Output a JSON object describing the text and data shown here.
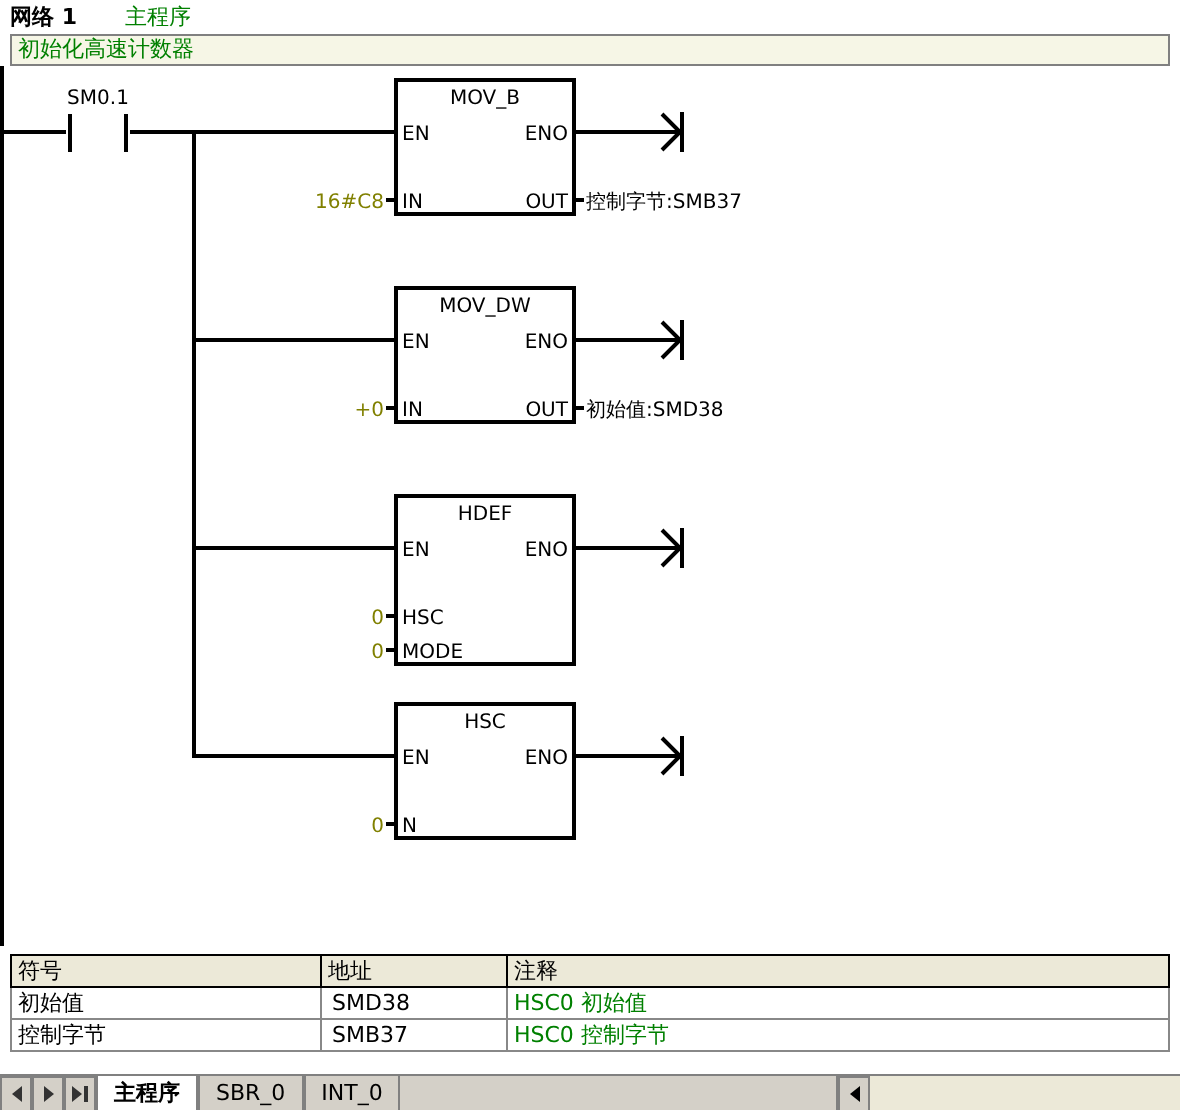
{
  "network": {
    "label": "网络 1",
    "title": "主程序",
    "comment": "初始化高速计数器"
  },
  "contact": {
    "label": "SM0.1"
  },
  "blocks": [
    {
      "name": "MOV_B",
      "inputs": [
        {
          "pin": "EN"
        },
        {
          "pin": "IN",
          "value": "16#C8"
        }
      ],
      "outputs": [
        {
          "pin": "ENO"
        },
        {
          "pin": "OUT",
          "value": "控制字节:SMB37"
        }
      ]
    },
    {
      "name": "MOV_DW",
      "inputs": [
        {
          "pin": "EN"
        },
        {
          "pin": "IN",
          "value": "+0"
        }
      ],
      "outputs": [
        {
          "pin": "ENO"
        },
        {
          "pin": "OUT",
          "value": "初始值:SMD38"
        }
      ]
    },
    {
      "name": "HDEF",
      "inputs": [
        {
          "pin": "EN"
        },
        {
          "pin": "HSC",
          "value": "0"
        },
        {
          "pin": "MODE",
          "value": "0"
        }
      ],
      "outputs": [
        {
          "pin": "ENO"
        }
      ]
    },
    {
      "name": "HSC",
      "inputs": [
        {
          "pin": "EN"
        },
        {
          "pin": "N",
          "value": "0"
        }
      ],
      "outputs": [
        {
          "pin": "ENO"
        }
      ]
    }
  ],
  "symbol_table": {
    "columns": [
      "符号",
      "地址",
      "注释"
    ],
    "rows": [
      [
        "初始值",
        "SMD38",
        "HSC0 初始值"
      ],
      [
        "控制字节",
        "SMB37",
        "HSC0 控制字节"
      ]
    ]
  },
  "tabs": [
    {
      "label": "主程序",
      "selected": true
    },
    {
      "label": "SBR_0",
      "selected": false
    },
    {
      "label": "INT_0",
      "selected": false
    }
  ]
}
